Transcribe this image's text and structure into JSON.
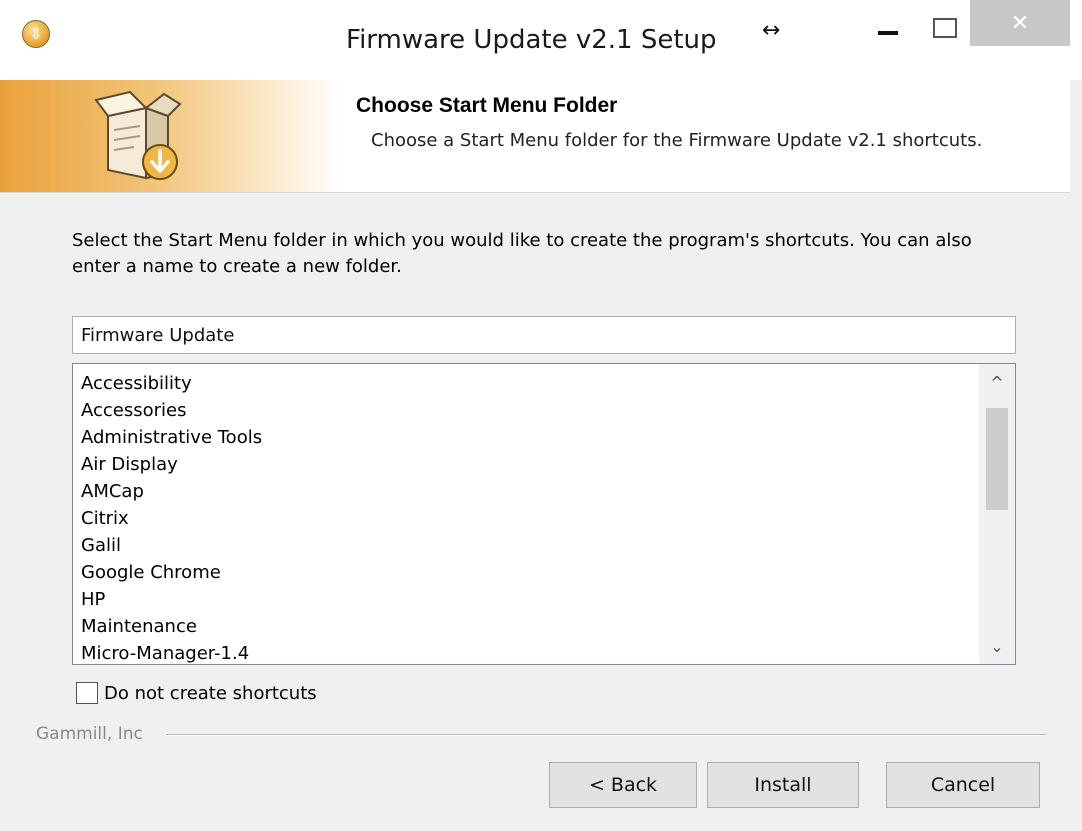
{
  "window": {
    "title": "Firmware Update v2.1 Setup",
    "resize_glyph": "↔",
    "close_glyph": "✕"
  },
  "app_icon": {
    "icon": "setup-installer-icon",
    "glyph": "⇩"
  },
  "header": {
    "title": "Choose Start Menu Folder",
    "subtitle": "Choose a Start Menu folder for the Firmware Update v2.1 shortcuts.",
    "icon": "box-download-icon"
  },
  "instructions": "Select the Start Menu folder in which you would like to create the program's shortcuts. You can also enter a name to create a new folder.",
  "folder_input": {
    "value": "Firmware Update"
  },
  "folder_list": {
    "items": [
      "Accessibility",
      "Accessories",
      "Administrative Tools",
      "Air Display",
      "AMCap",
      "Citrix",
      "Galil",
      "Google Chrome",
      "HP",
      "Maintenance",
      "Micro-Manager-1.4"
    ]
  },
  "scrollbar": {
    "up_glyph": "^",
    "down_glyph": "⌄"
  },
  "checkbox": {
    "label": "Do not create shortcuts",
    "checked": false
  },
  "brand": "Gammill, Inc",
  "buttons": {
    "back": "< Back",
    "install": "Install",
    "cancel": "Cancel"
  },
  "colors": {
    "banner_accent": "#eaa13b",
    "close_button": "#c7c7c7"
  }
}
